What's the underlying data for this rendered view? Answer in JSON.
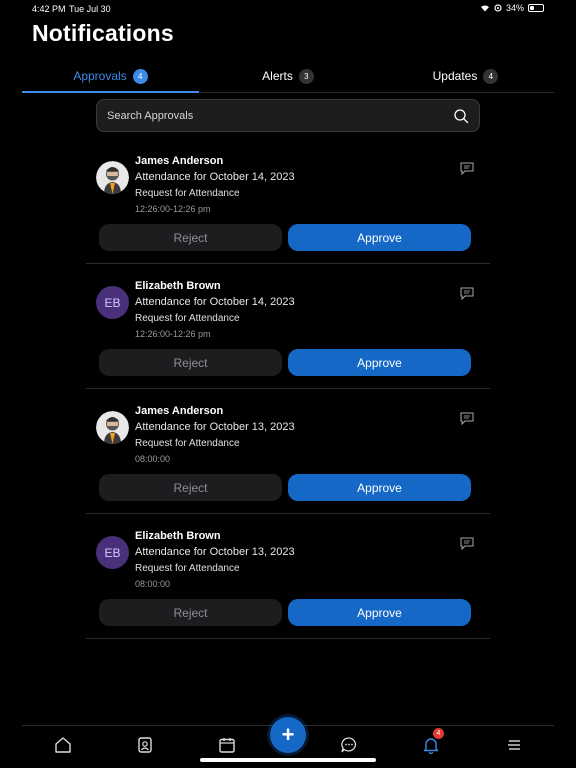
{
  "status": {
    "time": "4:42 PM",
    "date": "Tue Jul 30",
    "battery": "34%"
  },
  "title": "Notifications",
  "tabs": [
    {
      "label": "Approvals",
      "count": "4",
      "active": true
    },
    {
      "label": "Alerts",
      "count": "3",
      "active": false
    },
    {
      "label": "Updates",
      "count": "4",
      "active": false
    }
  ],
  "search": {
    "placeholder": "Search Approvals"
  },
  "cards": [
    {
      "name": "James Anderson",
      "title": "Attendance for October 14, 2023",
      "subtitle": "Request for Attendance",
      "time": "12:26:00-12:26 pm",
      "avatar": "photo",
      "reject": "Reject",
      "approve": "Approve"
    },
    {
      "name": "Elizabeth Brown",
      "initials": "EB",
      "title": "Attendance for October 14, 2023",
      "subtitle": "Request for Attendance",
      "time": "12:26:00-12:26 pm",
      "avatar": "initials",
      "reject": "Reject",
      "approve": "Approve"
    },
    {
      "name": "James Anderson",
      "title": "Attendance for October 13, 2023",
      "subtitle": "Request for Attendance",
      "time": "08:00:00",
      "avatar": "photo",
      "reject": "Reject",
      "approve": "Approve"
    },
    {
      "name": "Elizabeth Brown",
      "initials": "EB",
      "title": "Attendance for October 13, 2023",
      "subtitle": "Request for Attendance",
      "time": "08:00:00",
      "avatar": "initials",
      "reject": "Reject",
      "approve": "Approve"
    }
  ],
  "tabbar": {
    "items": [
      "home-icon",
      "contacts-icon",
      "calendar-icon",
      "add-icon",
      "chat-icon",
      "bell-icon",
      "menu-icon"
    ],
    "fab_label": "+",
    "bell_badge": "4"
  },
  "colors": {
    "accent": "#1568c6",
    "tab_active": "#3b8be8",
    "badge_alert": "#e53935",
    "avatar_initials_bg": "#4a2f7a"
  }
}
